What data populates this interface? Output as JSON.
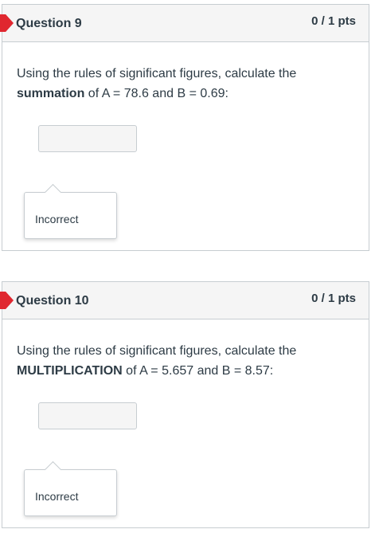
{
  "questions": [
    {
      "title": "Question 9",
      "points": "0 / 1 pts",
      "prompt_prefix": "Using the rules of significant figures, calculate the ",
      "prompt_bold": "summation",
      "prompt_suffix": " of A = 78.6 and B = 0.69:",
      "answer_value": "",
      "feedback": "Incorrect"
    },
    {
      "title": "Question 10",
      "points": "0 / 1 pts",
      "prompt_prefix": "Using the rules of significant figures, calculate the ",
      "prompt_bold": "MULTIPLICATION",
      "prompt_suffix": " of A = 5.657 and B = 8.57:",
      "answer_value": "",
      "feedback": "Incorrect"
    }
  ],
  "colors": {
    "incorrect_marker": "#e0272f",
    "header_bg": "#f5f5f5",
    "border": "#c7cdd1",
    "text": "#2d3b45"
  }
}
